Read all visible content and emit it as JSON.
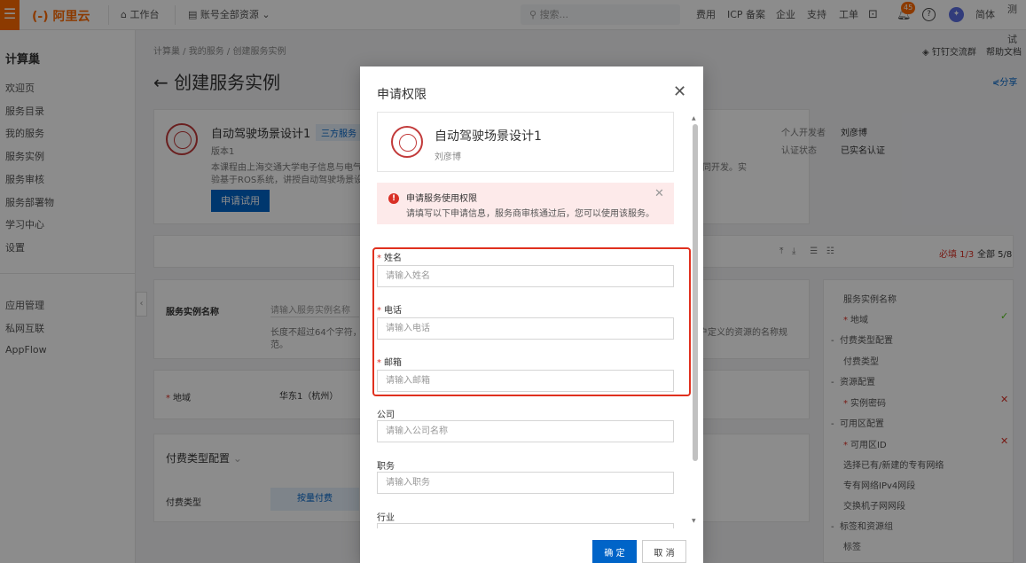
{
  "topbar": {
    "logo": "阿里云",
    "workbench": "工作台",
    "resources": "账号全部资源",
    "search_placeholder": "搜索...",
    "items": [
      "费用",
      "ICP 备案",
      "企业",
      "支持",
      "工单"
    ],
    "notification_count": "45",
    "lang": "简体",
    "user": "测试"
  },
  "sidebar": {
    "title": "计算巢",
    "items": [
      "欢迎页",
      "服务目录",
      "我的服务",
      "服务实例",
      "服务审核",
      "服务部署物",
      "学习中心",
      "设置"
    ],
    "items2": [
      "应用管理",
      "私网互联",
      "AppFlow"
    ]
  },
  "main": {
    "breadcrumb": "计算巢 / 我的服务 / 创建服务实例",
    "title": "创建服务实例",
    "links": [
      "钉钉交流群",
      "帮助文档",
      "分享"
    ],
    "service": {
      "name": "自动驾驶场景设计1",
      "tag": "三方服务",
      "version": "版本1",
      "desc1": "本课程由上海交通大学电子信息与电气",
      "desc2": "验基于ROS系统，讲授自动驾驶场景设计",
      "desc_tail": "同开发。实",
      "apply_button": "申请试用",
      "dev_label": "个人开发者",
      "dev_value": "刘彦博",
      "auth_label": "认证状态",
      "auth_value": "已实名认证"
    },
    "form_status": "必填 1/3",
    "form_total": "全部 5/8",
    "instance_name_label": "服务实例名称",
    "instance_name_placeholder": "请输入服务实例名称",
    "instance_name_hint1": "长度不超过64个字符，",
    "instance_name_hint2": "范。",
    "instance_name_hint_tail": "户定义的资源的名称规",
    "region_label": "地域",
    "region_value": "华东1（杭州）",
    "billing_section": "付费类型配置",
    "billing_label": "付费类型",
    "billing_value": "按量付费",
    "nav_items": [
      "服务实例名称",
      "地域",
      "付费类型配置",
      "付费类型",
      "资源配置",
      "实例密码",
      "可用区配置",
      "可用区ID",
      "选择已有/新建的专有网络",
      "专有网络IPv4网段",
      "交换机子网网段",
      "标签和资源组",
      "标签"
    ]
  },
  "modal": {
    "title": "申请权限",
    "service_name": "自动驾驶场景设计1",
    "service_author": "刘彦博",
    "alert_title": "申请服务使用权限",
    "alert_desc": "请填写以下申请信息，服务商审核通过后，您可以使用该服务。",
    "fields": [
      {
        "label": "姓名",
        "placeholder": "请输入姓名",
        "required": true
      },
      {
        "label": "电话",
        "placeholder": "请输入电话",
        "required": true
      },
      {
        "label": "邮箱",
        "placeholder": "请输入邮箱",
        "required": true
      },
      {
        "label": "公司",
        "placeholder": "请输入公司名称",
        "required": false
      },
      {
        "label": "职务",
        "placeholder": "请输入职务",
        "required": false
      },
      {
        "label": "行业",
        "placeholder": "",
        "required": false
      }
    ],
    "ok": "确 定",
    "cancel": "取 消"
  },
  "colors": {
    "accent": "#0064c8",
    "brand": "#ff6a00",
    "highlight": "#e0301e",
    "error": "#d93026"
  }
}
